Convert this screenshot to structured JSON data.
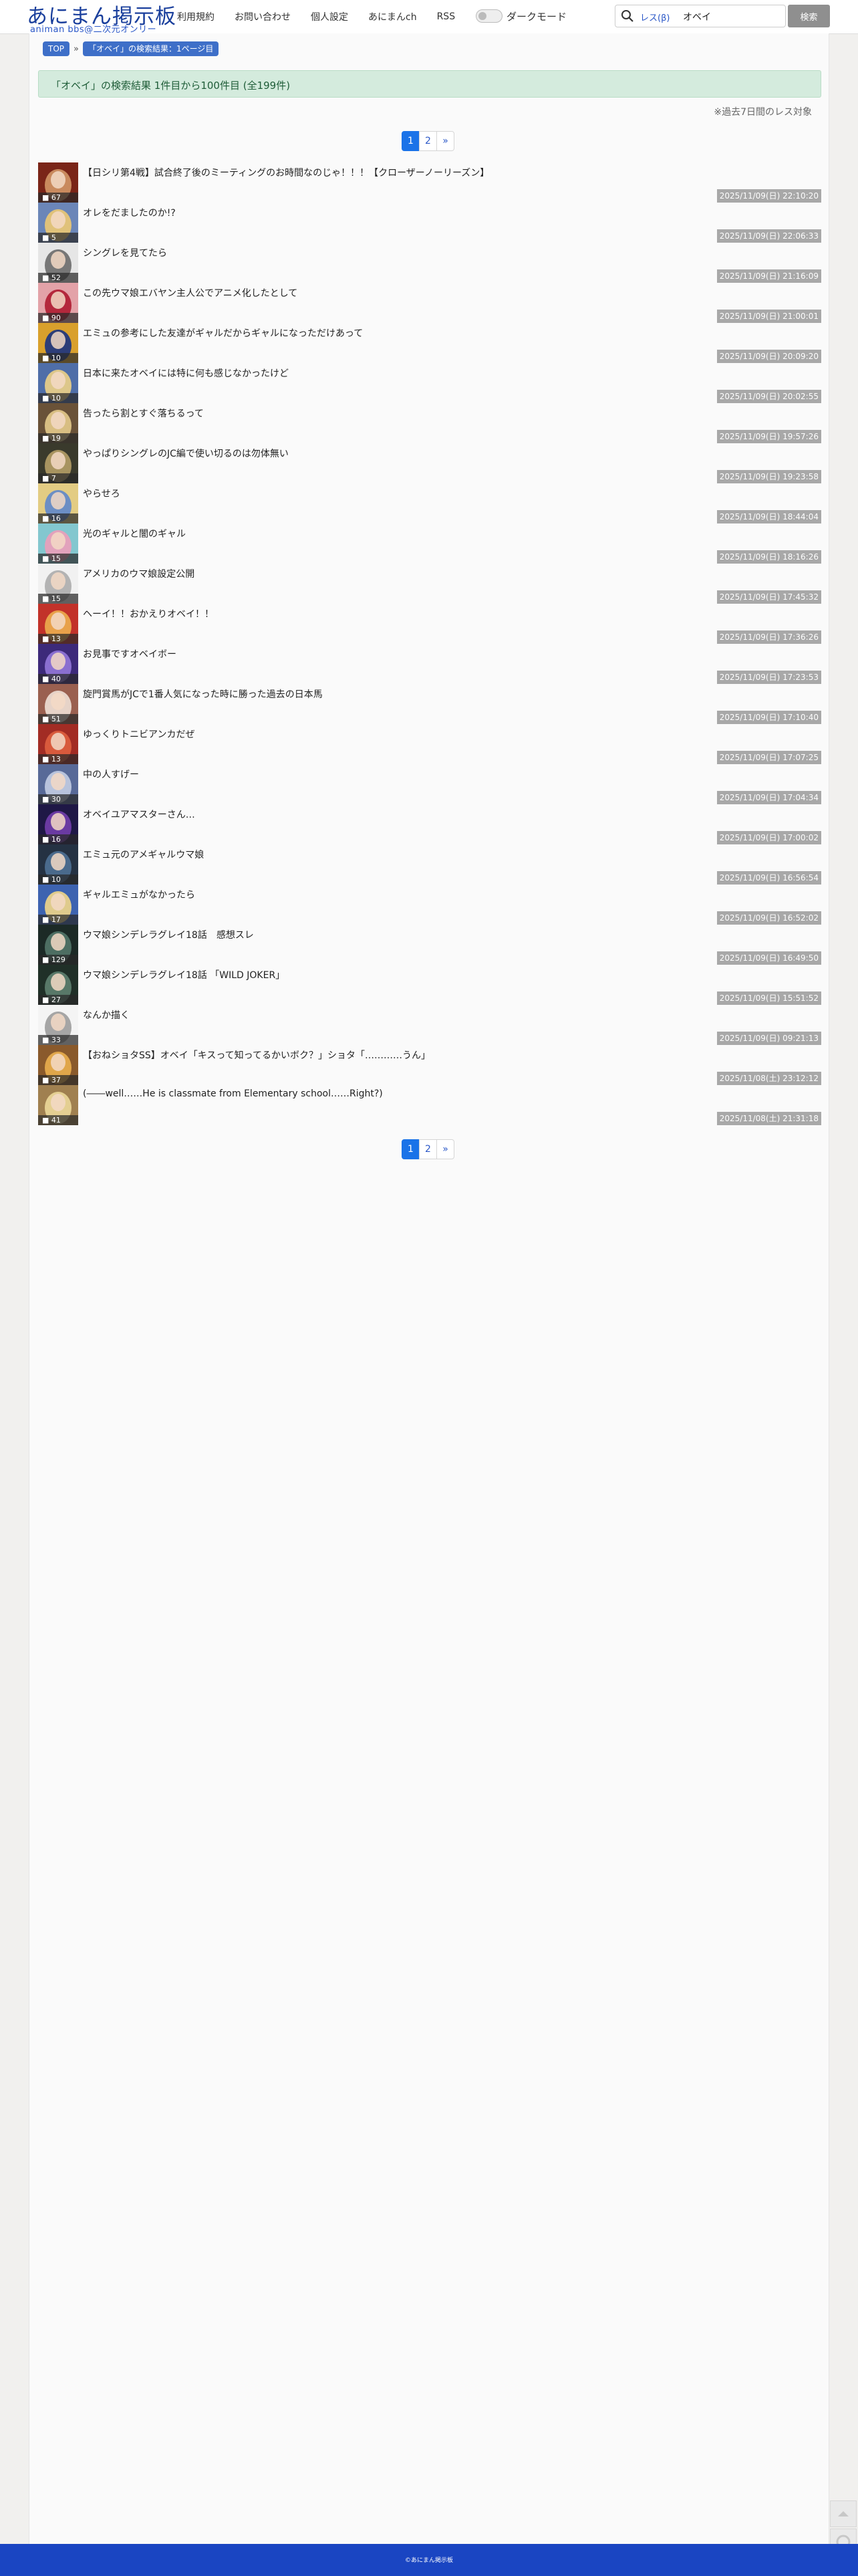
{
  "header": {
    "logo_title": "あにまん掲示板",
    "logo_sub": "animan bbs@二次元オンリー",
    "nav": [
      "利用規約",
      "お問い合わせ",
      "個人設定",
      "あにまんch",
      "RSS"
    ],
    "dark_mode_label": "ダークモード",
    "search_scope": "レス(β)",
    "search_value": "オベイ",
    "search_button": "検索"
  },
  "breadcrumb": {
    "top": "TOP",
    "current": "「オベイ」の検索結果：1ページ目"
  },
  "result_banner": "「オベイ」の検索結果 1件目から100件目 (全199件)",
  "note": "※過去7日間のレス対象",
  "pagination": {
    "pages": [
      "1",
      "2"
    ],
    "next": "»",
    "active": "1"
  },
  "threads": [
    {
      "title": "【日シリ第4戦】試合終了後のミーティングのお時間なのじゃ！！！【クローザーノーリーズン】",
      "count": "67",
      "date": "2025/11/09(日) 22:10:20",
      "thumb": [
        "#7a2518",
        "#c98a5e"
      ]
    },
    {
      "title": "オレをだましたのか!?",
      "count": "5",
      "date": "2025/11/09(日) 22:06:33",
      "thumb": [
        "#6b86b8",
        "#e0c27a"
      ]
    },
    {
      "title": "シングレを見てたら",
      "count": "52",
      "date": "2025/11/09(日) 21:16:09",
      "thumb": [
        "#e6e6e6",
        "#777777"
      ]
    },
    {
      "title": "この先ウマ娘エバヤン主人公でアニメ化したとして",
      "count": "90",
      "date": "2025/11/09(日) 21:00:01",
      "thumb": [
        "#e3a2a8",
        "#b4283c"
      ]
    },
    {
      "title": "エミュの参考にした友達がギャルだからギャルになっただけあって",
      "count": "10",
      "date": "2025/11/09(日) 20:09:20",
      "thumb": [
        "#d9a02c",
        "#2c3d78"
      ]
    },
    {
      "title": "日本に来たオベイには特に何も感じなかったけど",
      "count": "10",
      "date": "2025/11/09(日) 20:02:55",
      "thumb": [
        "#4f6ea8",
        "#ddc78a"
      ]
    },
    {
      "title": "告ったら割とすぐ落ちるって",
      "count": "19",
      "date": "2025/11/09(日) 19:57:26",
      "thumb": [
        "#6a5238",
        "#d8be82"
      ]
    },
    {
      "title": "やっぱりシングレのJC編で使い切るのは勿体無い",
      "count": "7",
      "date": "2025/11/09(日) 19:23:58",
      "thumb": [
        "#3a3a2c",
        "#a89460"
      ]
    },
    {
      "title": "やらせろ",
      "count": "16",
      "date": "2025/11/09(日) 18:44:04",
      "thumb": [
        "#e3cc83",
        "#6c8ec4"
      ]
    },
    {
      "title": "光のギャルと闇のギャル",
      "count": "15",
      "date": "2025/11/09(日) 18:16:26",
      "thumb": [
        "#83c7cf",
        "#e2a2bc"
      ]
    },
    {
      "title": "アメリカのウマ娘設定公開",
      "count": "15",
      "date": "2025/11/09(日) 17:45:32",
      "thumb": [
        "#f1f1f1",
        "#b3b3b3"
      ]
    },
    {
      "title": "ヘーイ！！おかえりオベイ！！",
      "count": "13",
      "date": "2025/11/09(日) 17:36:26",
      "thumb": [
        "#c2322a",
        "#e8a14a"
      ]
    },
    {
      "title": "お見事ですオベイボー",
      "count": "40",
      "date": "2025/11/09(日) 17:23:53",
      "thumb": [
        "#3d2a7a",
        "#8a6fd0"
      ]
    },
    {
      "title": "旋門賞馬がJCで1番人気になった時に勝った過去の日本馬",
      "count": "51",
      "date": "2025/11/09(日) 17:10:40",
      "thumb": [
        "#9a6050",
        "#e6d3c8"
      ]
    },
    {
      "title": "ゆっくりトニビアンカだぜ",
      "count": "13",
      "date": "2025/11/09(日) 17:07:25",
      "thumb": [
        "#a22c24",
        "#d85a3c"
      ]
    },
    {
      "title": "中の人すげー",
      "count": "30",
      "date": "2025/11/09(日) 17:04:34",
      "thumb": [
        "#586a98",
        "#b8c3dc"
      ]
    },
    {
      "title": "オベイユアマスターさん…",
      "count": "16",
      "date": "2025/11/09(日) 17:00:02",
      "thumb": [
        "#1f1846",
        "#6a3aa2"
      ]
    },
    {
      "title": "エミュ元のアメギャルウマ娘",
      "count": "10",
      "date": "2025/11/09(日) 16:56:54",
      "thumb": [
        "#253243",
        "#4a6a8c"
      ]
    },
    {
      "title": "ギャルエミュがなかったら",
      "count": "17",
      "date": "2025/11/09(日) 16:52:02",
      "thumb": [
        "#3d63b0",
        "#dfcb8c"
      ]
    },
    {
      "title": "ウマ娘シンデレラグレイ18話　感想スレ",
      "count": "129",
      "date": "2025/11/09(日) 16:49:50",
      "thumb": [
        "#1c2a26",
        "#4d6e62"
      ]
    },
    {
      "title": "ウマ娘シンデレラグレイ18話 「WILD JOKER」",
      "count": "27",
      "date": "2025/11/09(日) 15:51:52",
      "thumb": [
        "#203028",
        "#587868"
      ]
    },
    {
      "title": "なんか描く",
      "count": "33",
      "date": "2025/11/09(日) 09:21:13",
      "thumb": [
        "#f4f4f4",
        "#a5a5a5"
      ]
    },
    {
      "title": "【おねショタSS】オベイ「キスって知ってるかいボク？」ショタ「…………うん」",
      "count": "37",
      "date": "2025/11/08(土) 23:12:12",
      "thumb": [
        "#8a5a2c",
        "#e0a64a"
      ]
    },
    {
      "title": "(――well……He is classmate from Elementary school……Right?)",
      "count": "41",
      "date": "2025/11/08(土) 21:31:18",
      "thumb": [
        "#a08050",
        "#e4cf92"
      ]
    }
  ],
  "footer": "©あにまん掲示板"
}
